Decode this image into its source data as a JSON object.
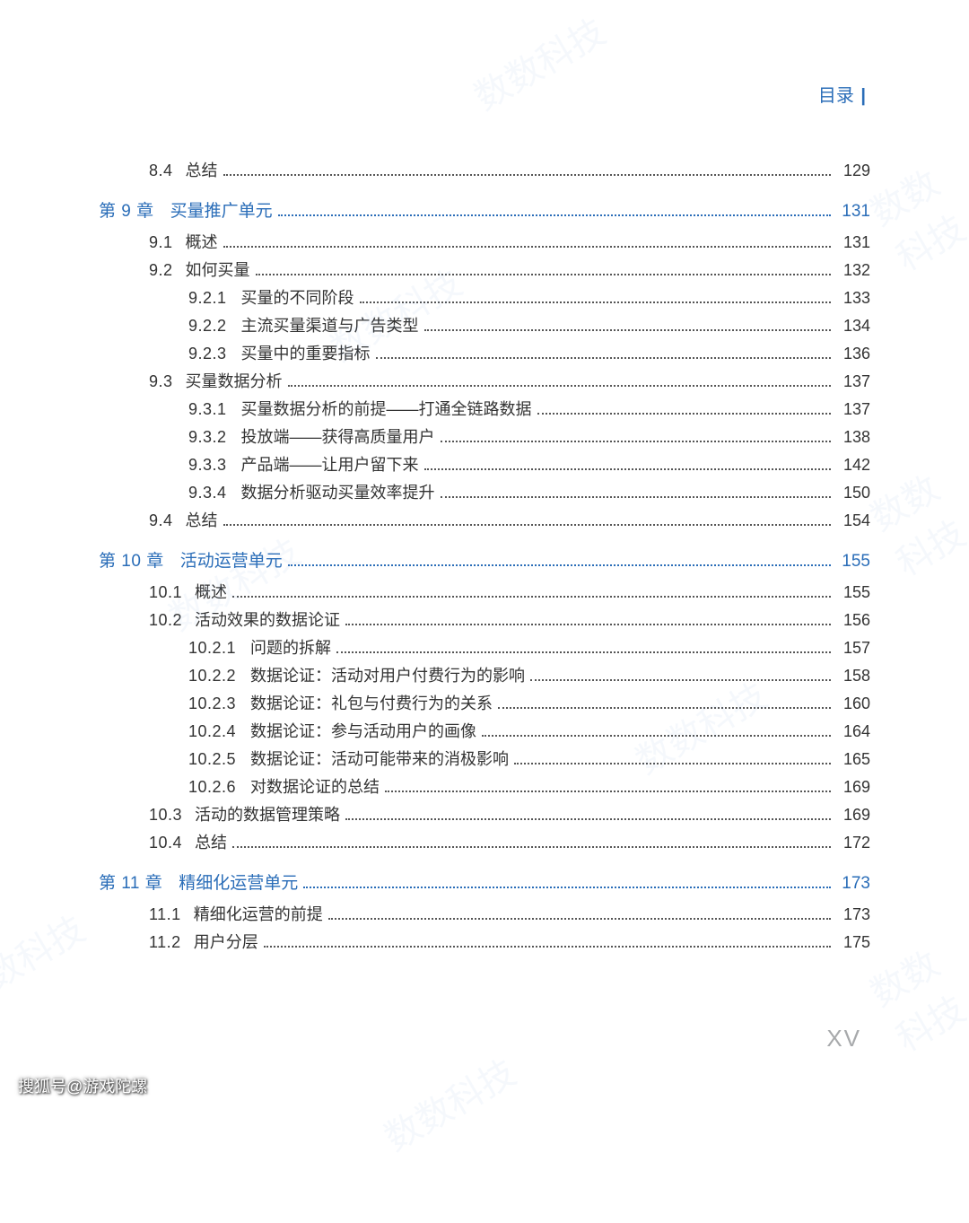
{
  "header": {
    "label": "目录",
    "bar": "|"
  },
  "toc": [
    {
      "level": "section",
      "num": "8.4",
      "title": "总结",
      "page": "129"
    },
    {
      "level": "chapter",
      "num": "第 9 章",
      "title": "买量推广单元",
      "page": "131"
    },
    {
      "level": "section",
      "num": "9.1",
      "title": "概述",
      "page": "131"
    },
    {
      "level": "section",
      "num": "9.2",
      "title": "如何买量",
      "page": "132"
    },
    {
      "level": "subsection",
      "num": "9.2.1",
      "title": "买量的不同阶段",
      "page": "133"
    },
    {
      "level": "subsection",
      "num": "9.2.2",
      "title": "主流买量渠道与广告类型",
      "page": "134"
    },
    {
      "level": "subsection",
      "num": "9.2.3",
      "title": "买量中的重要指标",
      "page": "136"
    },
    {
      "level": "section",
      "num": "9.3",
      "title": "买量数据分析",
      "page": "137"
    },
    {
      "level": "subsection",
      "num": "9.3.1",
      "title": "买量数据分析的前提——打通全链路数据",
      "page": "137"
    },
    {
      "level": "subsection",
      "num": "9.3.2",
      "title": "投放端——获得高质量用户",
      "page": "138"
    },
    {
      "level": "subsection",
      "num": "9.3.3",
      "title": "产品端——让用户留下来",
      "page": "142"
    },
    {
      "level": "subsection",
      "num": "9.3.4",
      "title": "数据分析驱动买量效率提升",
      "page": "150"
    },
    {
      "level": "section",
      "num": "9.4",
      "title": "总结",
      "page": "154"
    },
    {
      "level": "chapter",
      "num": "第 10 章",
      "title": "活动运营单元",
      "page": "155"
    },
    {
      "level": "section",
      "num": "10.1",
      "title": "概述",
      "page": "155"
    },
    {
      "level": "section",
      "num": "10.2",
      "title": "活动效果的数据论证",
      "page": "156"
    },
    {
      "level": "subsection",
      "num": "10.2.1",
      "title": "问题的拆解",
      "page": "157"
    },
    {
      "level": "subsection",
      "num": "10.2.2",
      "title": "数据论证：活动对用户付费行为的影响",
      "page": "158"
    },
    {
      "level": "subsection",
      "num": "10.2.3",
      "title": "数据论证：礼包与付费行为的关系",
      "page": "160"
    },
    {
      "level": "subsection",
      "num": "10.2.4",
      "title": "数据论证：参与活动用户的画像",
      "page": "164"
    },
    {
      "level": "subsection",
      "num": "10.2.5",
      "title": "数据论证：活动可能带来的消极影响",
      "page": "165"
    },
    {
      "level": "subsection",
      "num": "10.2.6",
      "title": "对数据论证的总结",
      "page": "169"
    },
    {
      "level": "section",
      "num": "10.3",
      "title": "活动的数据管理策略",
      "page": "169"
    },
    {
      "level": "section",
      "num": "10.4",
      "title": "总结",
      "page": "172"
    },
    {
      "level": "chapter",
      "num": "第 11 章",
      "title": "精细化运营单元",
      "page": "173"
    },
    {
      "level": "section",
      "num": "11.1",
      "title": "精细化运营的前提",
      "page": "173"
    },
    {
      "level": "section",
      "num": "11.2",
      "title": "用户分层",
      "page": "175"
    }
  ],
  "footer": {
    "pageNumeral": "XV"
  },
  "watermark": {
    "source": "搜狐号@游戏陀螺",
    "bgText": "数数科技"
  }
}
